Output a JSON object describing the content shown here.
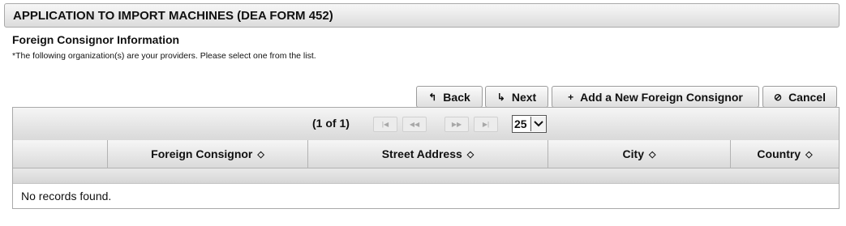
{
  "page": {
    "title": "APPLICATION TO IMPORT MACHINES (DEA FORM 452)",
    "section_title": "Foreign Consignor Information",
    "instruction": "*The following organization(s) are your providers. Please select one from the list."
  },
  "toolbar": {
    "back_label": "Back",
    "next_label": "Next",
    "add_label": "Add a New Foreign Consignor",
    "cancel_label": "Cancel"
  },
  "paginator": {
    "summary": "(1 of 1)",
    "first": "|◀",
    "prev": "◀◀",
    "next": "▶▶",
    "last": "▶|",
    "rows_per_page": "25"
  },
  "table": {
    "columns": [
      {
        "label": ""
      },
      {
        "label": "Foreign Consignor"
      },
      {
        "label": "Street Address"
      },
      {
        "label": "City"
      },
      {
        "label": "Country"
      }
    ],
    "sort_glyph": "◇",
    "empty_message": "No records found."
  },
  "icons": {
    "back": "back-arrow-icon",
    "next": "next-arrow-icon",
    "add": "plus-icon",
    "cancel": "cancel-circle-icon",
    "dropdown": "chevron-down-icon"
  }
}
